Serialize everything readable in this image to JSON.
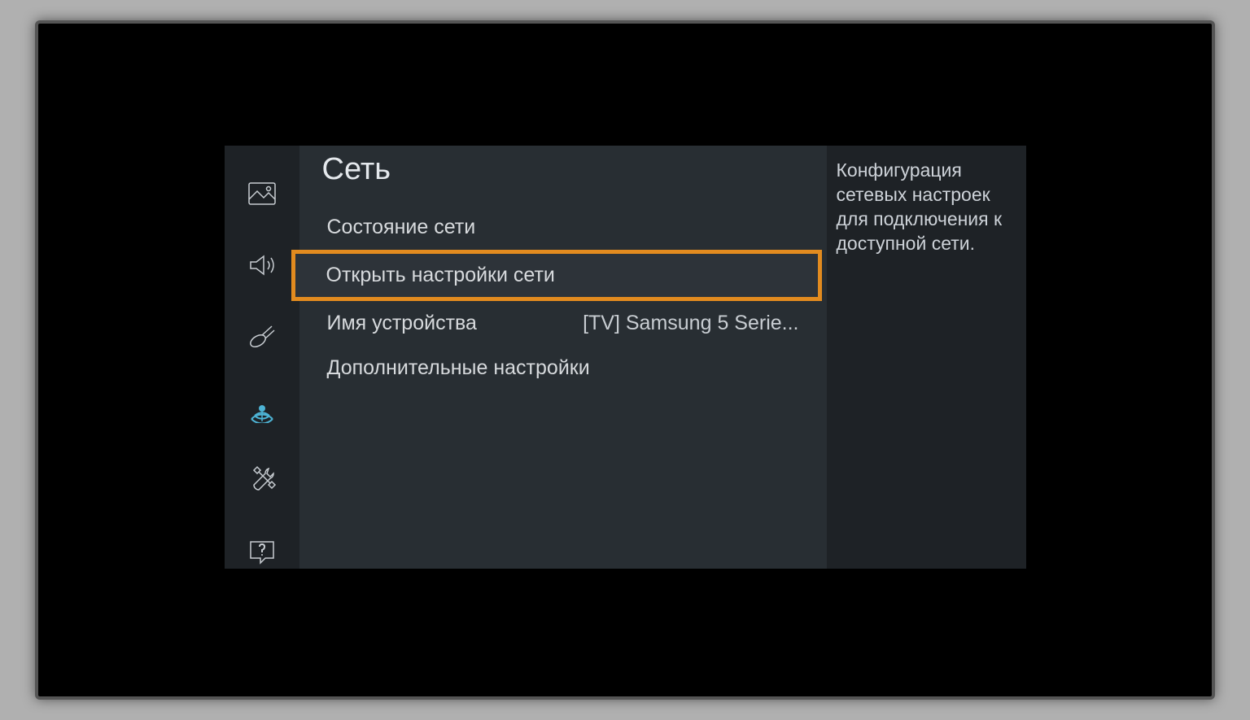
{
  "sidebar": {
    "icons": [
      {
        "name": "picture-icon",
        "active": false
      },
      {
        "name": "sound-icon",
        "active": false
      },
      {
        "name": "broadcast-icon",
        "active": false
      },
      {
        "name": "network-icon",
        "active": true
      },
      {
        "name": "tools-icon",
        "active": false
      },
      {
        "name": "support-icon",
        "active": false
      }
    ]
  },
  "main": {
    "title": "Сеть",
    "items": [
      {
        "label": "Состояние сети",
        "value": "",
        "selected": false
      },
      {
        "label": "Открыть настройки сети",
        "value": "",
        "selected": true
      },
      {
        "label": "Имя устройства",
        "value": "[TV] Samsung 5 Serie...",
        "selected": false
      },
      {
        "label": "Дополнительные настройки",
        "value": "",
        "selected": false
      }
    ]
  },
  "description": "Конфигурация сетевых настроек для подключения к доступной сети."
}
